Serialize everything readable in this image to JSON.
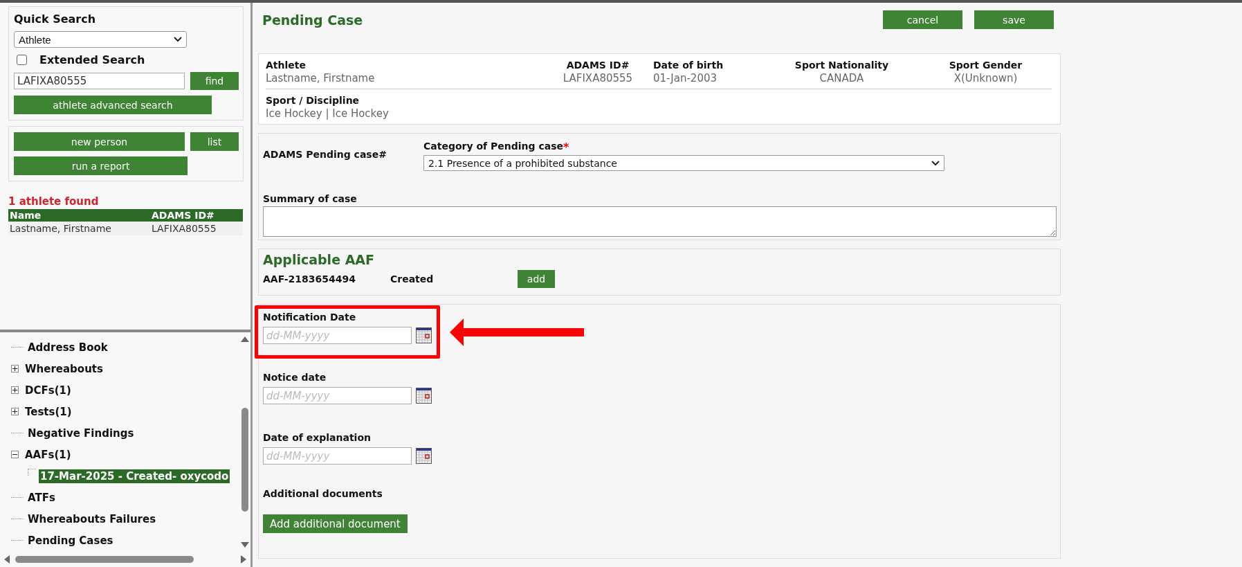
{
  "left": {
    "quick_search": {
      "title": "Quick Search",
      "type_select": "Athlete",
      "extended_search": {
        "label": "Extended Search",
        "checked": false
      },
      "query": "LAFIXA80555",
      "find_button": "find",
      "advanced_button": "athlete advanced search"
    },
    "actions": [
      "new person",
      "list",
      "run a report"
    ],
    "results": {
      "count": "1 athlete found",
      "columns": [
        "Name",
        "ADAMS ID#"
      ],
      "rows": [
        [
          "Lastname, Firstname",
          "LAFIXA80555"
        ]
      ]
    },
    "tree": [
      {
        "label": "Address Book",
        "selected": false
      },
      {
        "label": "Whereabouts",
        "expanded": false,
        "selected": false
      },
      {
        "label": "DCFs(1)",
        "expanded": false,
        "selected": false
      },
      {
        "label": "Tests(1)",
        "expanded": false,
        "selected": false
      },
      {
        "label": "Negative Findings",
        "selected": false
      },
      {
        "label": "AAFs(1)",
        "expanded": true,
        "selected": false,
        "children": [
          {
            "label": "17-Mar-2025 - Created- oxycodo",
            "selected": true
          }
        ]
      },
      {
        "label": "ATFs",
        "selected": false
      },
      {
        "label": "Whereabouts Failures",
        "selected": false
      },
      {
        "label": "Pending Cases",
        "selected": false
      }
    ]
  },
  "main": {
    "title": "Pending Case",
    "buttons": [
      "cancel",
      "save"
    ],
    "athlete_card": {
      "fields": [
        {
          "label": "Athlete",
          "value": "Lastname, Firstname"
        },
        {
          "label": "ADAMS ID#",
          "value": "LAFIXA80555"
        },
        {
          "label": "Date of birth",
          "value": "01-Jan-2003"
        },
        {
          "label": "Sport Nationality",
          "value": "CANADA"
        },
        {
          "label": "Sport Gender",
          "value": "X(Unknown)"
        }
      ],
      "discipline": {
        "label": "Sport / Discipline",
        "value": "Ice Hockey | Ice Hockey"
      }
    },
    "case_card": {
      "case_number_label": "ADAMS Pending case#",
      "category": {
        "label": "Category of Pending case",
        "required_mark": "*",
        "value": "2.1 Presence of a prohibited substance"
      },
      "summary": {
        "label": "Summary of case"
      }
    },
    "aaf_card": {
      "title": "Applicable AAF",
      "aaf_id": "AAF-2183654494",
      "status": "Created",
      "add_button": "add"
    },
    "dates_card": {
      "date_fields": [
        {
          "label": "Notification Date",
          "placeholder": "dd-MM-yyyy",
          "highlighted": true
        },
        {
          "label": "Notice date",
          "placeholder": "dd-MM-yyyy",
          "highlighted": false
        },
        {
          "label": "Date of explanation",
          "placeholder": "dd-MM-yyyy",
          "highlighted": false
        }
      ],
      "documents_label": "Additional documents",
      "documents_button": "Add additional document"
    }
  }
}
